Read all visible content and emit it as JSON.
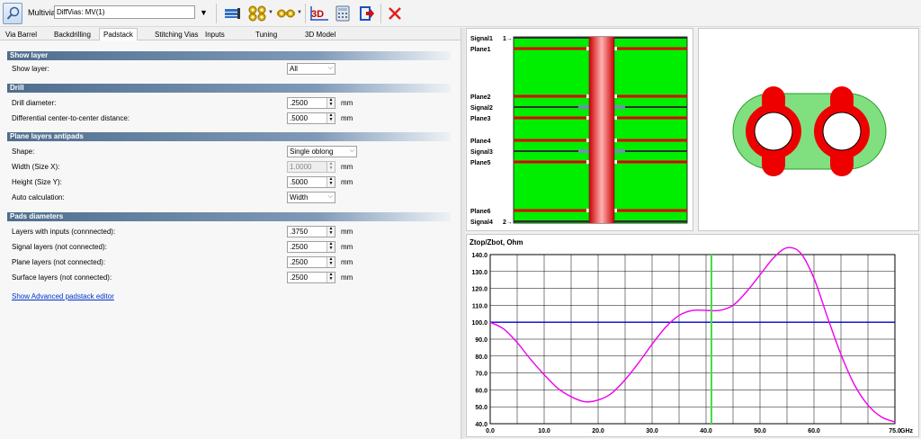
{
  "toolbar": {
    "multivia_label": "Multivia:",
    "multivia_value": "DiffVias: MV(1)",
    "icons": [
      "search-icon",
      "layer-stack-icon",
      "vias-cluster-icon",
      "via-array-icon",
      "3d-view-icon",
      "calculator-icon",
      "export-icon",
      "close-icon"
    ]
  },
  "tabs": [
    "Via Barrel",
    "Backdrilling",
    "Padstack",
    "Stitching Vias",
    "Inputs",
    "Tuning",
    "3D Model"
  ],
  "active_tab": "Padstack",
  "show_layer": {
    "header": "Show layer",
    "label": "Show layer:",
    "value": "All"
  },
  "drill": {
    "header": "Drill",
    "diameter_label": "Drill diameter:",
    "diameter_value": ".2500",
    "distance_label": "Differential center-to-center distance:",
    "distance_value": ".5000",
    "unit": "mm"
  },
  "antipads": {
    "header": "Plane layers antipads",
    "shape_label": "Shape:",
    "shape_value": "Single oblong",
    "width_label": "Width (Size X):",
    "width_value": "1.0000",
    "height_label": "Height (Size Y):",
    "height_value": ".5000",
    "auto_label": "Auto calculation:",
    "auto_value": "Width",
    "unit": "mm"
  },
  "pads": {
    "header": "Pads diameters",
    "rows": [
      {
        "label": "Layers with inputs (connnected):",
        "value": ".3750"
      },
      {
        "label": "Signal layers (not connected):",
        "value": ".2500"
      },
      {
        "label": "Plane layers (not connected):",
        "value": ".2500"
      },
      {
        "label": "Surface layers (not connected):",
        "value": ".2500"
      }
    ],
    "unit": "mm",
    "link": "Show Advanced padstack editor"
  },
  "stackup": {
    "layers": [
      "Signal1",
      "Plane1",
      "Plane2",
      "Signal2",
      "Plane3",
      "Plane4",
      "Signal3",
      "Plane5",
      "Plane6",
      "Signal4"
    ],
    "port1": "1",
    "port2": "2",
    "colors": {
      "dielectric": "#00ee00",
      "copper": "#dd0000",
      "barrel": "#ff5555"
    }
  },
  "chart_data": {
    "type": "line",
    "title": "Ztop/Zbot, Ohm",
    "xlabel": "GHz",
    "ylabel": "",
    "xlim": [
      0,
      75
    ],
    "ylim": [
      40,
      140
    ],
    "x_ticks": [
      "0.0",
      "10.0",
      "20.0",
      "30.0",
      "40.0",
      "50.0",
      "60.0",
      "75.0"
    ],
    "y_ticks": [
      "40.0",
      "50.0",
      "60.0",
      "70.0",
      "80.0",
      "90.0",
      "100.0",
      "110.0",
      "120.0",
      "130.0",
      "140.0"
    ],
    "grid": true,
    "series": [
      {
        "color": "#0000cc",
        "x": [
          0,
          75
        ],
        "y": [
          100,
          100
        ]
      },
      {
        "color": "#ee00ee",
        "x": [
          0,
          2.5,
          5,
          7.5,
          10,
          12.5,
          15,
          17.5,
          20,
          22.5,
          25,
          27.5,
          30,
          32.5,
          35,
          37.5,
          40,
          42.5,
          45,
          47.5,
          50,
          52.5,
          55,
          57.5,
          60,
          62.5,
          65,
          67.5,
          70,
          72.5,
          75
        ],
        "y": [
          100,
          96,
          88,
          78,
          69,
          61,
          56,
          53,
          54,
          58,
          66,
          76,
          87,
          97,
          104,
          107,
          107,
          107,
          110,
          118,
          128,
          138,
          144,
          141,
          126,
          103,
          81,
          63,
          51,
          44,
          41
        ]
      }
    ],
    "marker": {
      "x": 41,
      "color": "#44dd44"
    }
  }
}
